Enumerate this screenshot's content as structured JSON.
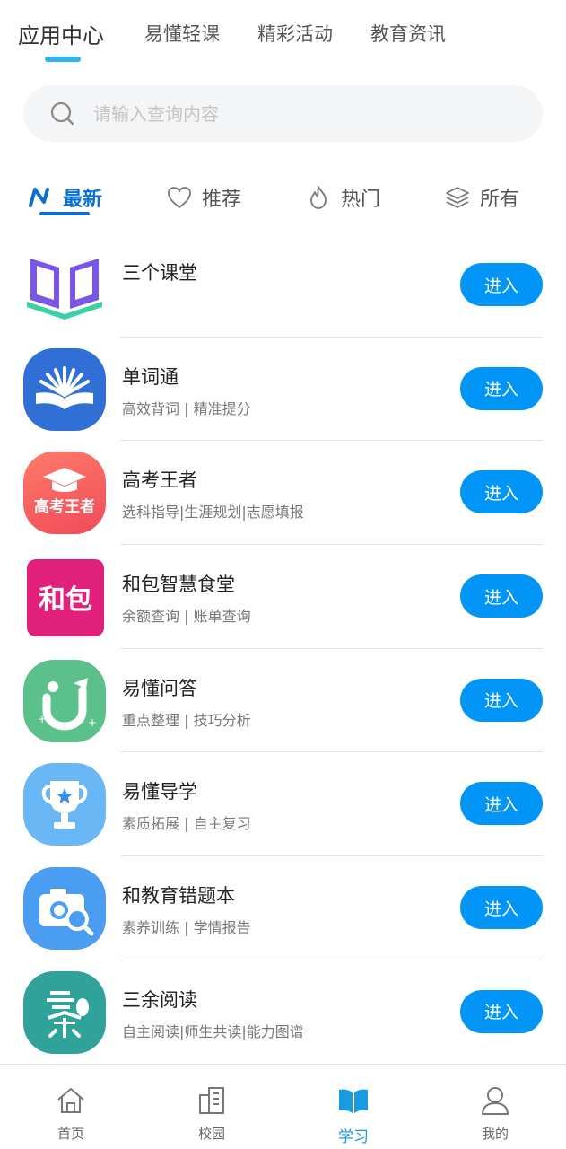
{
  "top_tabs": [
    {
      "label": "应用中心"
    },
    {
      "label": "易懂轻课"
    },
    {
      "label": "精彩活动"
    },
    {
      "label": "教育资讯"
    }
  ],
  "search": {
    "placeholder": "请输入查询内容"
  },
  "sub_tabs": [
    {
      "label": "最新",
      "icon": "new-n-icon"
    },
    {
      "label": "推荐",
      "icon": "heart-icon"
    },
    {
      "label": "热门",
      "icon": "flame-icon"
    },
    {
      "label": "所有",
      "icon": "layers-icon"
    }
  ],
  "apps": [
    {
      "title": "三个课堂",
      "subtitle": "",
      "button": "进入",
      "icon": "book-icon"
    },
    {
      "title": "单词通",
      "subtitle": "高效背词 | 精准提分",
      "button": "进入",
      "icon": "open-book-fan-icon"
    },
    {
      "title": "高考王者",
      "subtitle": "选科指导|生涯规划|志愿填报",
      "button": "进入",
      "icon": "graduation-cap-icon",
      "icon_text": "高考王者"
    },
    {
      "title": "和包智慧食堂",
      "subtitle": "余额查询 | 账单查询",
      "button": "进入",
      "icon": "hebao-logo-icon",
      "icon_text": "和包"
    },
    {
      "title": "易懂问答",
      "subtitle": "重点整理 | 技巧分析",
      "button": "进入",
      "icon": "u-question-icon"
    },
    {
      "title": "易懂导学",
      "subtitle": "素质拓展 | 自主复习",
      "button": "进入",
      "icon": "trophy-icon"
    },
    {
      "title": "和教育错题本",
      "subtitle": "素养训练 | 学情报告",
      "button": "进入",
      "icon": "camera-search-icon"
    },
    {
      "title": "三余阅读",
      "subtitle": "自主阅读|师生共读|能力图谱",
      "button": "进入",
      "icon": "reading-icon"
    }
  ],
  "bottom_nav": [
    {
      "label": "首页",
      "icon": "home-icon"
    },
    {
      "label": "校园",
      "icon": "campus-icon"
    },
    {
      "label": "学习",
      "icon": "study-book-icon"
    },
    {
      "label": "我的",
      "icon": "user-icon"
    }
  ],
  "colors": {
    "accent": "#0095f6",
    "tab_underline": "#2cb5e8",
    "sub_tab_active": "#0a6fd0",
    "nav_active": "#1a9ae0"
  }
}
